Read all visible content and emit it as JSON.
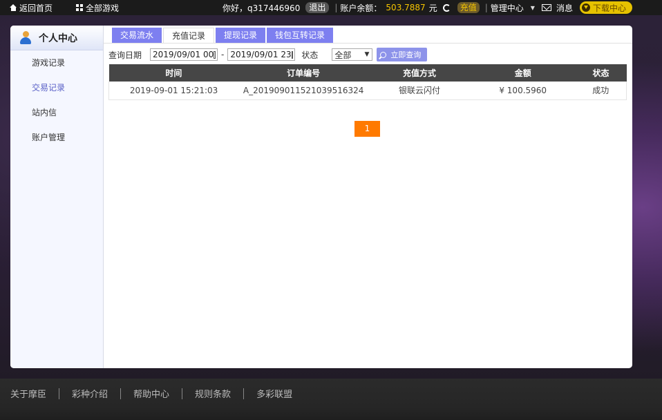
{
  "topbar": {
    "home": "返回首页",
    "games": "全部游戏",
    "greeting": "你好，q317446960",
    "logout": "退出",
    "balance_label": "账户余额：",
    "balance_value": "503.7887",
    "balance_unit": "元",
    "recharge": "充值",
    "manage": "管理中心",
    "messages": "消息",
    "download": "下载中心"
  },
  "sidebar": {
    "title": "个人中心",
    "items": [
      "游戏记录",
      "交易记录",
      "站内信",
      "账户管理"
    ],
    "active_index": 1
  },
  "tabs": [
    "交易流水",
    "充值记录",
    "提现记录",
    "钱包互转记录"
  ],
  "active_tab": 1,
  "query": {
    "date_label": "查询日期",
    "start": "2019/09/01 00",
    "dash": "-",
    "end": "2019/09/01 23",
    "status_label": "状态",
    "status_value": "全部",
    "search": "立即查询"
  },
  "table": {
    "columns": [
      "时间",
      "订单编号",
      "充值方式",
      "金额",
      "状态"
    ],
    "rows": [
      [
        "2019-09-01 15:21:03",
        "A_20190901152103951632​4",
        "银联云闪付",
        "¥ 100.5960",
        "成功"
      ]
    ]
  },
  "pager": {
    "current": "1"
  },
  "footer": [
    "关于摩臣",
    "彩种介绍",
    "帮助中心",
    "规则条款",
    "多彩联盟"
  ]
}
